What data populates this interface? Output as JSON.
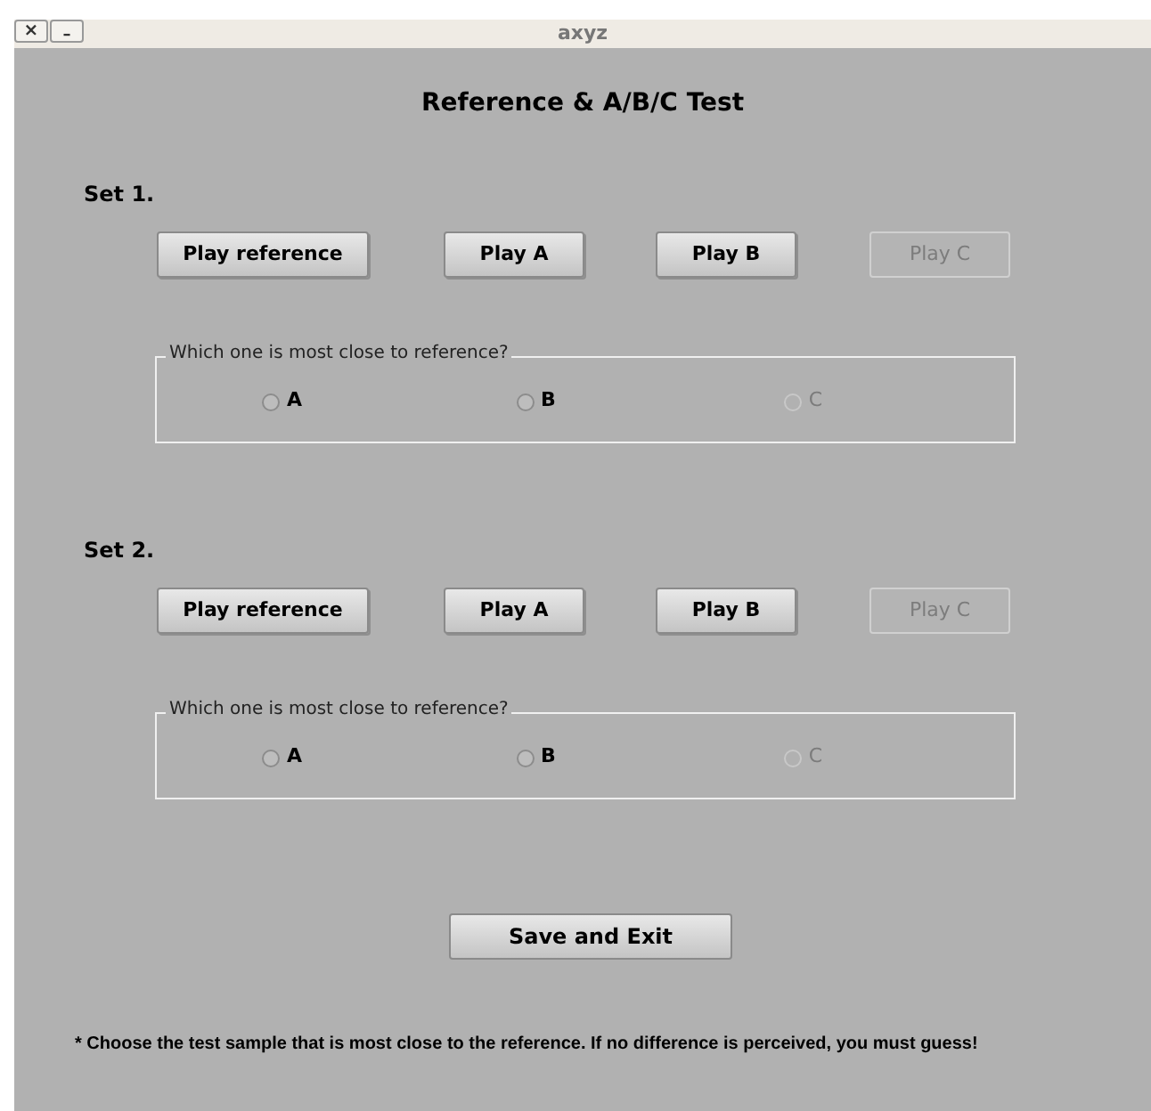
{
  "window": {
    "title": "axyz",
    "buttons": [
      {
        "kind": "close",
        "label": "×"
      },
      {
        "kind": "minimize",
        "label": "–"
      }
    ]
  },
  "heading": "Reference & A/B/C Test",
  "sets": [
    {
      "label": "Set 1.",
      "buttons": [
        {
          "label": "Play reference",
          "disabled": false
        },
        {
          "label": "Play A",
          "disabled": false
        },
        {
          "label": "Play B",
          "disabled": false
        },
        {
          "label": "Play C",
          "disabled": true
        }
      ],
      "question": "Which one is most close to reference?",
      "options": [
        {
          "label": "A",
          "selected": false,
          "disabled": false
        },
        {
          "label": "B",
          "selected": false,
          "disabled": false
        },
        {
          "label": "C",
          "selected": false,
          "disabled": true
        }
      ]
    },
    {
      "label": "Set 2.",
      "buttons": [
        {
          "label": "Play reference",
          "disabled": false
        },
        {
          "label": "Play A",
          "disabled": false
        },
        {
          "label": "Play B",
          "disabled": false
        },
        {
          "label": "Play C",
          "disabled": true
        }
      ],
      "question": "Which one is most close to reference?",
      "options": [
        {
          "label": "A",
          "selected": false,
          "disabled": false
        },
        {
          "label": "B",
          "selected": false,
          "disabled": false
        },
        {
          "label": "C",
          "selected": false,
          "disabled": true
        }
      ]
    }
  ],
  "save_button": "Save and Exit",
  "footnote": "* Choose the test sample that is most close to the reference. If no difference is perceived, you must guess!"
}
